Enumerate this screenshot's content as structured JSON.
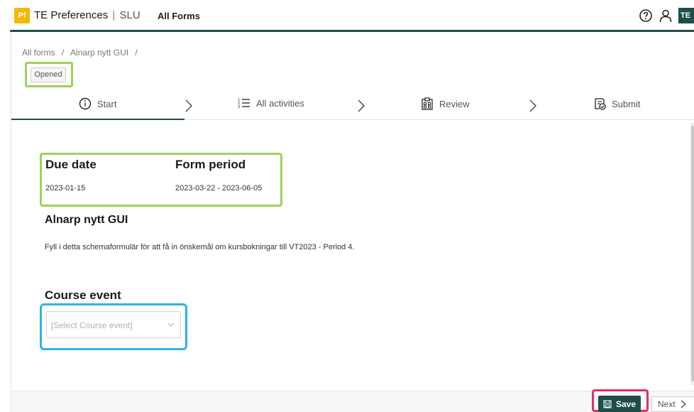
{
  "header": {
    "logo_text": "Pf",
    "app_name": "TE Preferences",
    "separator": "|",
    "org": "SLU",
    "nav_all_forms": "All Forms",
    "user_initials": "TE"
  },
  "breadcrumb": {
    "items": [
      "All forms",
      "/",
      "Alnarp nytt GUI",
      "/"
    ]
  },
  "status": "Opened",
  "steps": [
    {
      "label": "Start",
      "icon": "info-icon"
    },
    {
      "label": "All activities",
      "icon": "list-icon"
    },
    {
      "label": "Review",
      "icon": "review-icon"
    },
    {
      "label": "Submit",
      "icon": "submit-icon"
    }
  ],
  "form": {
    "due_date_label": "Due date",
    "due_date_value": "2023-01-15",
    "form_period_label": "Form period",
    "form_period_value": "2023-03-22 - 2023-06-05",
    "title": "Alnarp nytt GUI",
    "description": "Fyll i detta schemaformulär för att få in önskemål om kursbokningar till VT2023 - Period 4.",
    "course_event_label": "Course event",
    "course_event_placeholder": "[Select Course event]"
  },
  "footer": {
    "save_label": "Save",
    "next_label": "Next"
  },
  "colors": {
    "brand": "#1e4d4a",
    "logo": "#f5b800",
    "highlight_green": "#9ed25a",
    "highlight_blue": "#2db3e8",
    "highlight_pink": "#e0306a"
  }
}
